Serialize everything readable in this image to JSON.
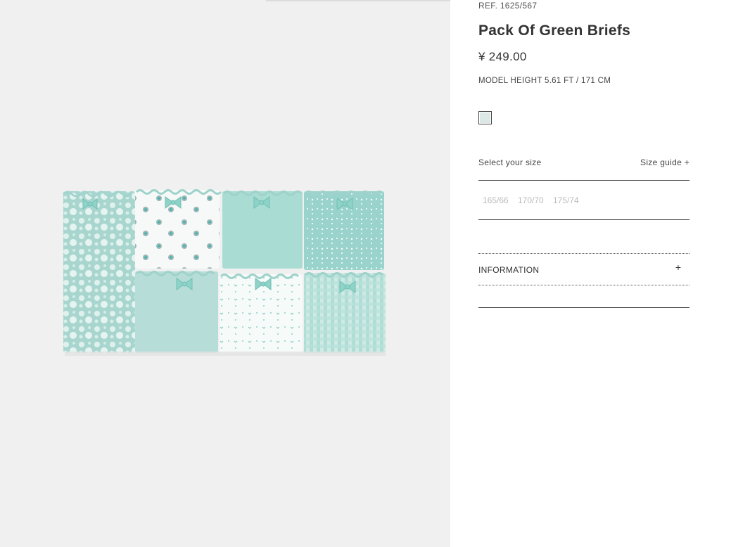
{
  "product": {
    "ref": "REF. 1625/567",
    "name": "Pack Of Green Briefs",
    "price": "¥ 249.00",
    "model_height": "MODEL HEIGHT 5.61 FT / 171 CM",
    "image_alt": "Pack of seven green briefs",
    "swatch_color": "#dbe8e6"
  },
  "size": {
    "label": "Select your size",
    "guide_label": "Size guide +",
    "options": [
      "165/66",
      "170/70",
      "175/74"
    ]
  },
  "information": {
    "label": "INFORMATION",
    "toggle": "+"
  },
  "colors": {
    "mint": "#a9dad3",
    "mint_light": "#c4e6e0",
    "text": "#333333",
    "muted": "#bbbbbb"
  }
}
